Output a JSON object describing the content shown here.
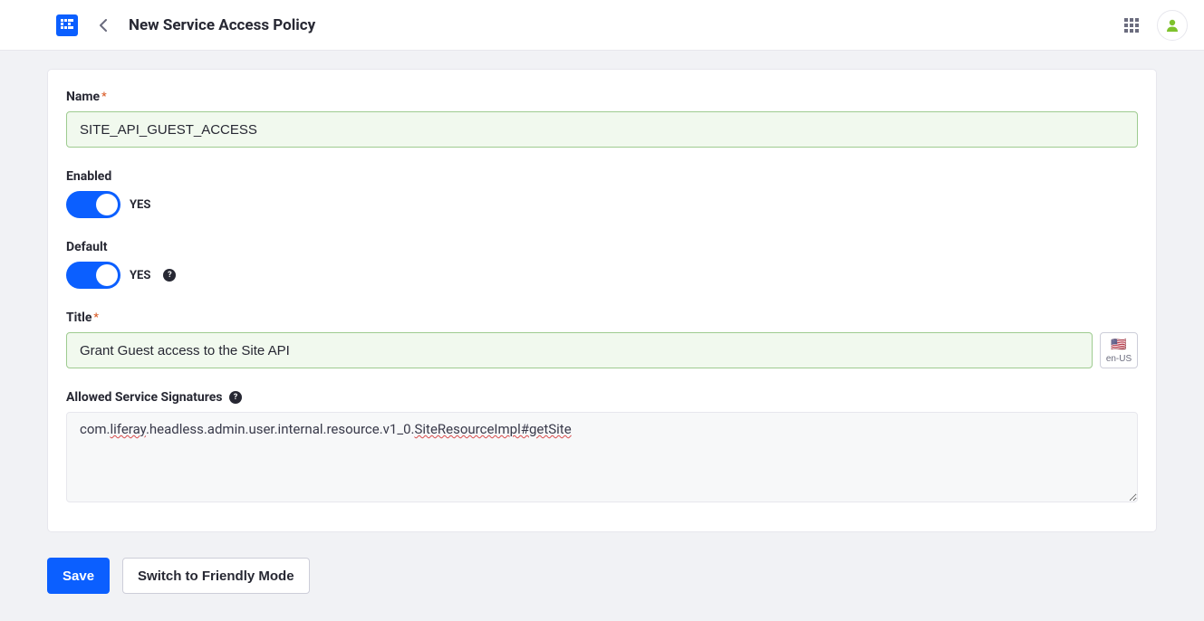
{
  "header": {
    "title": "New Service Access Policy"
  },
  "form": {
    "name": {
      "label": "Name",
      "value": "SITE_API_GUEST_ACCESS",
      "required": true
    },
    "enabled": {
      "label": "Enabled",
      "state_text": "YES",
      "value": true
    },
    "default": {
      "label": "Default",
      "state_text": "YES",
      "value": true
    },
    "title": {
      "label": "Title",
      "value": "Grant Guest access to the Site API",
      "required": true,
      "locale_code": "en-US",
      "locale_flag": "🇺🇸"
    },
    "signatures": {
      "label": "Allowed Service Signatures",
      "value": "com.liferay.headless.admin.user.internal.resource.v1_0.SiteResourceImpl#getSite",
      "parts": {
        "p1": "com.",
        "p2": "liferay",
        "p3": ".headless.admin.user.internal.resource.v1_0.",
        "p4": "SiteResourceImpl#getSite"
      }
    }
  },
  "actions": {
    "save": "Save",
    "switch_mode": "Switch to Friendly Mode"
  }
}
